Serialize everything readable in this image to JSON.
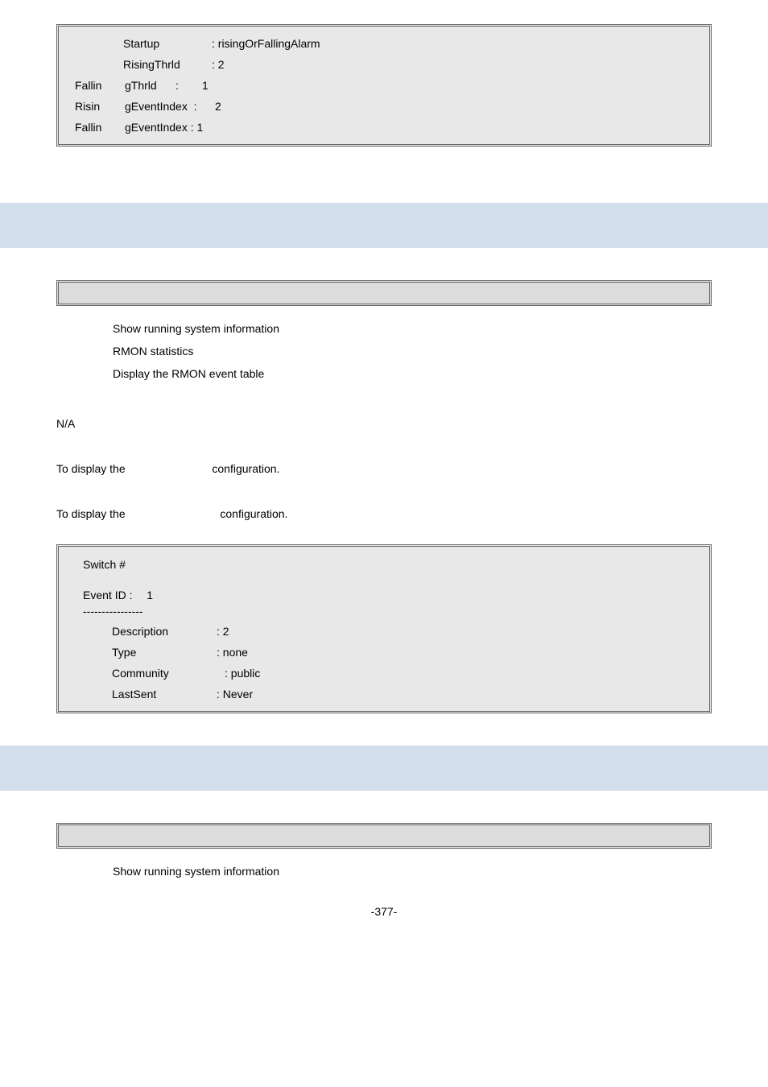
{
  "box1": {
    "rows": [
      {
        "c1": "",
        "c2": "Startup",
        "rest": ": risingOrFallingAlarm"
      },
      {
        "c1": "",
        "c2": "RisingThrld",
        "rest": ": 2"
      },
      {
        "c1": "Fallin",
        "c2": "gThrld      :",
        "rest": "1"
      },
      {
        "c1": "Risin",
        "c2": "gEventIndex  :",
        "rest": "2"
      },
      {
        "c1": "Fallin",
        "c2": "gEventIndex : 1",
        "rest": ""
      }
    ]
  },
  "list1": [
    "Show running system information",
    "RMON statistics",
    "Display the RMON event table"
  ],
  "na": "N/A",
  "line1a": "To display the",
  "line1b": "configuration.",
  "line2a": "To display the",
  "line2b": "configuration.",
  "box2": {
    "header": "Switch #",
    "eventLabel": "Event ID :",
    "eventVal": "1",
    "sep": "----------------",
    "rows": [
      {
        "k": "Description",
        "v": ": 2"
      },
      {
        "k": "Type",
        "v": ": none"
      },
      {
        "k": "Community",
        "v": ": public"
      },
      {
        "k": "LastSent",
        "v": ": Never"
      }
    ]
  },
  "footerList": "Show running system information",
  "pageNumber": "-377-"
}
